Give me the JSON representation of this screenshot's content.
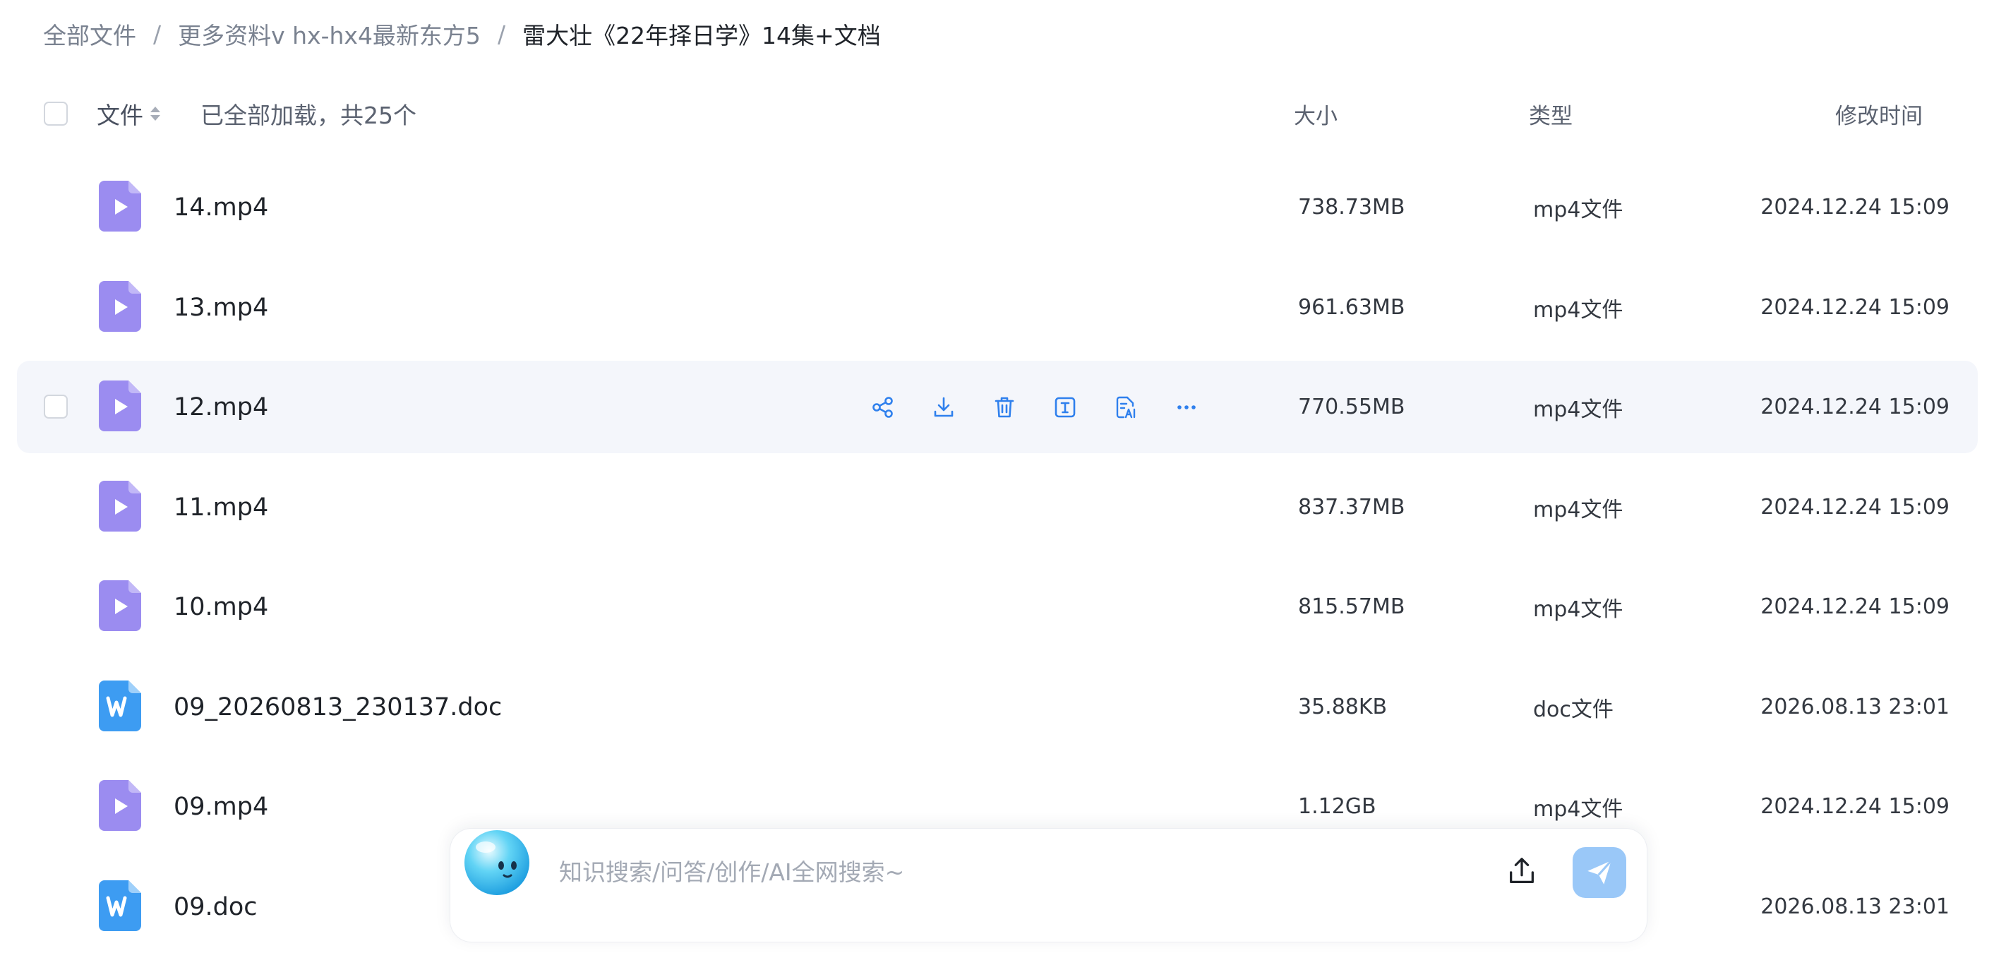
{
  "breadcrumb": {
    "items": [
      "全部文件",
      "更多资料v hx-hx4最新东方5"
    ],
    "separator": "/",
    "current": "雷大壮《22年择日学》14集+文档"
  },
  "header": {
    "file_label": "文件",
    "loaded_text": "已全部加载，共25个",
    "size_label": "大小",
    "type_label": "类型",
    "time_label": "修改时间"
  },
  "files": [
    {
      "name": "14.mp4",
      "size": "738.73MB",
      "type": "mp4文件",
      "modified": "2024.12.24 15:09",
      "kind": "video"
    },
    {
      "name": "13.mp4",
      "size": "961.63MB",
      "type": "mp4文件",
      "modified": "2024.12.24 15:09",
      "kind": "video"
    },
    {
      "name": "12.mp4",
      "size": "770.55MB",
      "type": "mp4文件",
      "modified": "2024.12.24 15:09",
      "kind": "video"
    },
    {
      "name": "11.mp4",
      "size": "837.37MB",
      "type": "mp4文件",
      "modified": "2024.12.24 15:09",
      "kind": "video"
    },
    {
      "name": "10.mp4",
      "size": "815.57MB",
      "type": "mp4文件",
      "modified": "2024.12.24 15:09",
      "kind": "video"
    },
    {
      "name": "09_20260813_230137.doc",
      "size": "35.88KB",
      "type": "doc文件",
      "modified": "2026.08.13 23:01",
      "kind": "word"
    },
    {
      "name": "09.mp4",
      "size": "1.12GB",
      "type": "mp4文件",
      "modified": "2024.12.24 15:09",
      "kind": "video"
    },
    {
      "name": "09.doc",
      "size": "",
      "type": "",
      "modified": "2026.08.13 23:01",
      "kind": "word"
    }
  ],
  "row_actions": [
    "share-icon",
    "download-icon",
    "delete-icon",
    "rename-icon",
    "ai-summary-icon",
    "more-icon"
  ],
  "ai_bar": {
    "placeholder": "知识搜索/问答/创作/AI全网搜索~"
  },
  "colors": {
    "video_icon": "#9b8cf0",
    "word_icon": "#3d9cf2",
    "action_blue": "#2f80ed",
    "hover_row_bg": "#f4f6fb",
    "send_button": "#9ac8f8"
  }
}
